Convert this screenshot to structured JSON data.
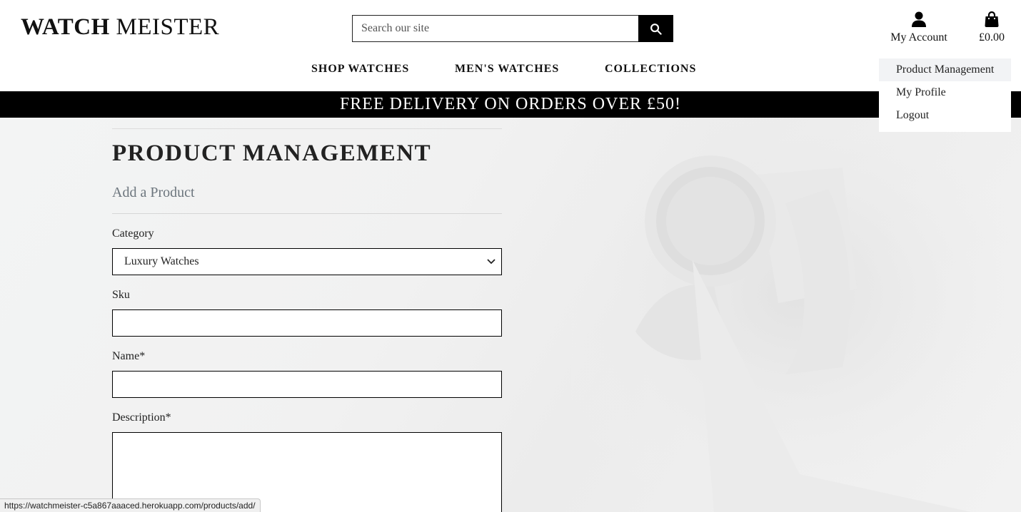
{
  "header": {
    "logo_bold": "WATCH",
    "logo_rest": " MEISTER",
    "search": {
      "placeholder": "Search our site",
      "value": ""
    },
    "account_label": "My Account",
    "cart_total": "£0.00"
  },
  "nav": {
    "items": [
      {
        "label": "SHOP WATCHES"
      },
      {
        "label": "MEN'S WATCHES"
      },
      {
        "label": "COLLECTIONS"
      }
    ]
  },
  "account_menu": {
    "items": [
      {
        "label": "Product Management",
        "active": true
      },
      {
        "label": "My Profile"
      },
      {
        "label": "Logout"
      }
    ]
  },
  "banner": {
    "text": "FREE DELIVERY ON ORDERS OVER £50!"
  },
  "main": {
    "title": "PRODUCT MANAGEMENT",
    "subtitle": "Add a Product",
    "form": {
      "category_label": "Category",
      "category_value": "Luxury Watches",
      "sku_label": "Sku",
      "sku_value": "",
      "name_label": "Name*",
      "name_value": "",
      "description_label": "Description*",
      "description_value": ""
    }
  },
  "status_bar": {
    "url": "https://watchmeister-c5a867aaaced.herokuapp.com/products/add/"
  },
  "icons": {
    "search": "search-icon",
    "account": "user-icon",
    "cart": "shopping-bag-icon",
    "select": "chevron-down-icon"
  },
  "colors": {
    "banner_bg": "#000000",
    "banner_text": "#ffffff",
    "subtitle": "#6c757d",
    "active_menu_bg": "#f2f3f5"
  }
}
